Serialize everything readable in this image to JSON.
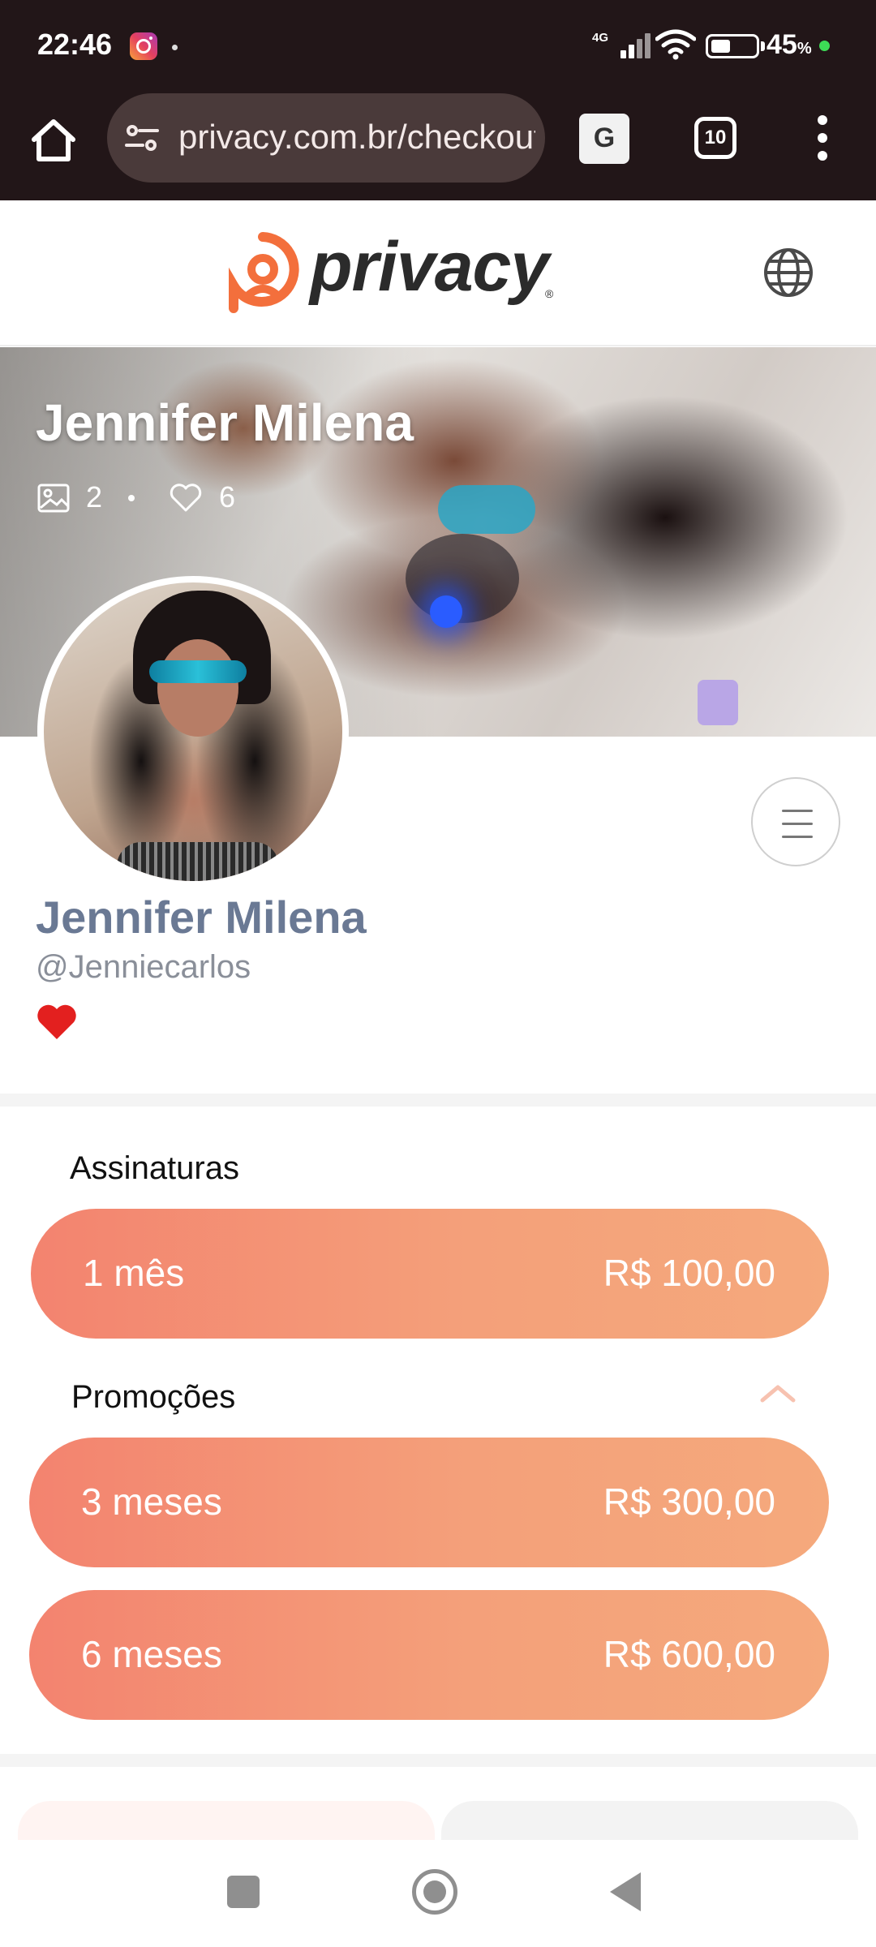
{
  "status_bar": {
    "time": "22:46",
    "network": "4G",
    "battery_percent": "45",
    "battery_unit": "%",
    "battery_level": 0.45
  },
  "browser": {
    "url": "privacy.com.br/checkout",
    "tab_count": "10",
    "translate_glyph": "G"
  },
  "site": {
    "brand": "privacy",
    "brand_mark": "®",
    "accent_color": "#f36f3c"
  },
  "cover": {
    "name": "Jennifer Milena",
    "photos_count": "2",
    "likes_count": "6"
  },
  "profile": {
    "name": "Jennifer Milena",
    "handle": "@Jenniecarlos"
  },
  "subscriptions": {
    "title": "Assinaturas",
    "plans": [
      {
        "label": "1 mês",
        "price": "R$ 100,00"
      }
    ]
  },
  "promotions": {
    "title": "Promoções",
    "plans": [
      {
        "label": "3 meses",
        "price": "R$ 300,00"
      },
      {
        "label": "6 meses",
        "price": "R$ 600,00"
      }
    ]
  },
  "colors": {
    "plan_gradient_start": "#f3836f",
    "plan_gradient_end": "#f5a97c",
    "profile_name": "#6a7994"
  }
}
